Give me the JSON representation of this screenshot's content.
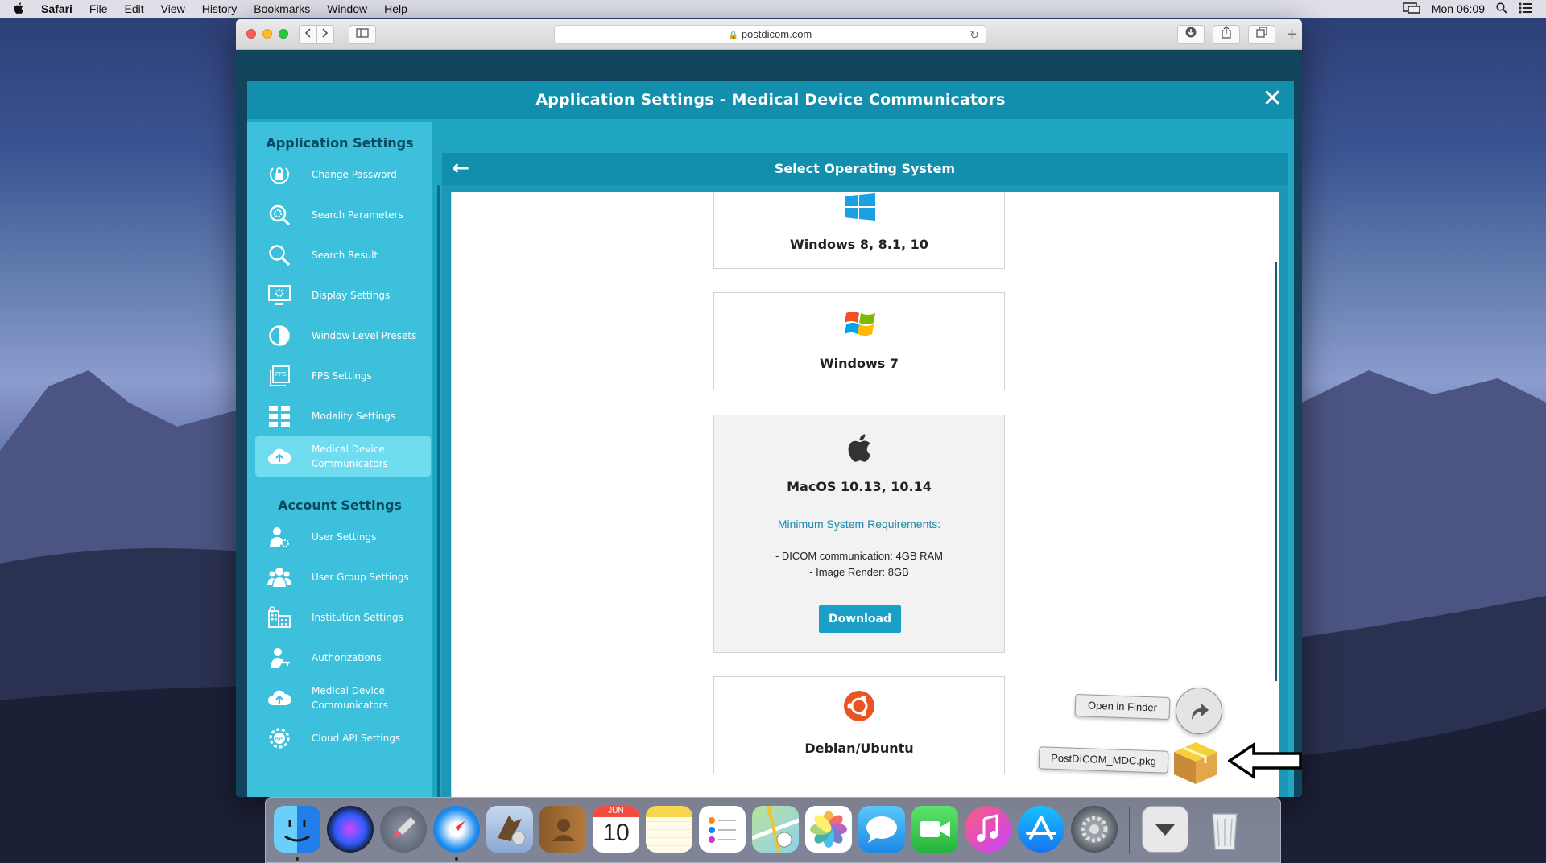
{
  "menubar": {
    "apple": "",
    "items": [
      "Safari",
      "File",
      "Edit",
      "View",
      "History",
      "Bookmarks",
      "Window",
      "Help"
    ],
    "clock": "Mon 06:09"
  },
  "browser": {
    "url": "postdicom.com"
  },
  "modal": {
    "title": "Application Settings - Medical Device Communicators",
    "close": "✕"
  },
  "sidebar": {
    "app_heading": "Application Settings",
    "app_items": [
      {
        "label": "Change Password",
        "icon": "lock-icon"
      },
      {
        "label": "Search Parameters",
        "icon": "search-gear-icon"
      },
      {
        "label": "Search Result",
        "icon": "search-icon"
      },
      {
        "label": "Display Settings",
        "icon": "monitor-gear-icon"
      },
      {
        "label": "Window Level Presets",
        "icon": "contrast-icon"
      },
      {
        "label": "FPS Settings",
        "icon": "fps-icon"
      },
      {
        "label": "Modality Settings",
        "icon": "grid-icon"
      },
      {
        "label": "Medical Device Communicators",
        "icon": "cloud-upload-icon",
        "active": true
      }
    ],
    "account_heading": "Account Settings",
    "account_items": [
      {
        "label": "User Settings",
        "icon": "user-gear-icon"
      },
      {
        "label": "User Group Settings",
        "icon": "users-icon"
      },
      {
        "label": "Institution Settings",
        "icon": "building-icon"
      },
      {
        "label": "Authorizations",
        "icon": "user-key-icon"
      },
      {
        "label": "Medical Device Communicators",
        "icon": "cloud-upload-icon"
      },
      {
        "label": "Cloud API Settings",
        "icon": "api-gear-icon"
      }
    ]
  },
  "content": {
    "title": "Select Operating System",
    "back": "←",
    "os_cards": [
      {
        "name": "Windows 8, 8.1, 10",
        "icon": "windows10-icon"
      },
      {
        "name": "Windows 7",
        "icon": "windows7-icon"
      },
      {
        "name": "MacOS 10.13, 10.14",
        "icon": "apple-icon",
        "requirements_title": "Minimum System Requirements:",
        "requirements": [
          "- DICOM communication: 4GB RAM",
          "- Image Render: 8GB"
        ],
        "download_label": "Download"
      },
      {
        "name": "Debian/Ubuntu",
        "icon": "ubuntu-icon"
      }
    ]
  },
  "download_popup": {
    "open_in_finder": "Open in Finder",
    "filename": "PostDICOM_MDC.pkg"
  },
  "dock": {
    "calendar_month": "JUN",
    "calendar_day": "10"
  }
}
